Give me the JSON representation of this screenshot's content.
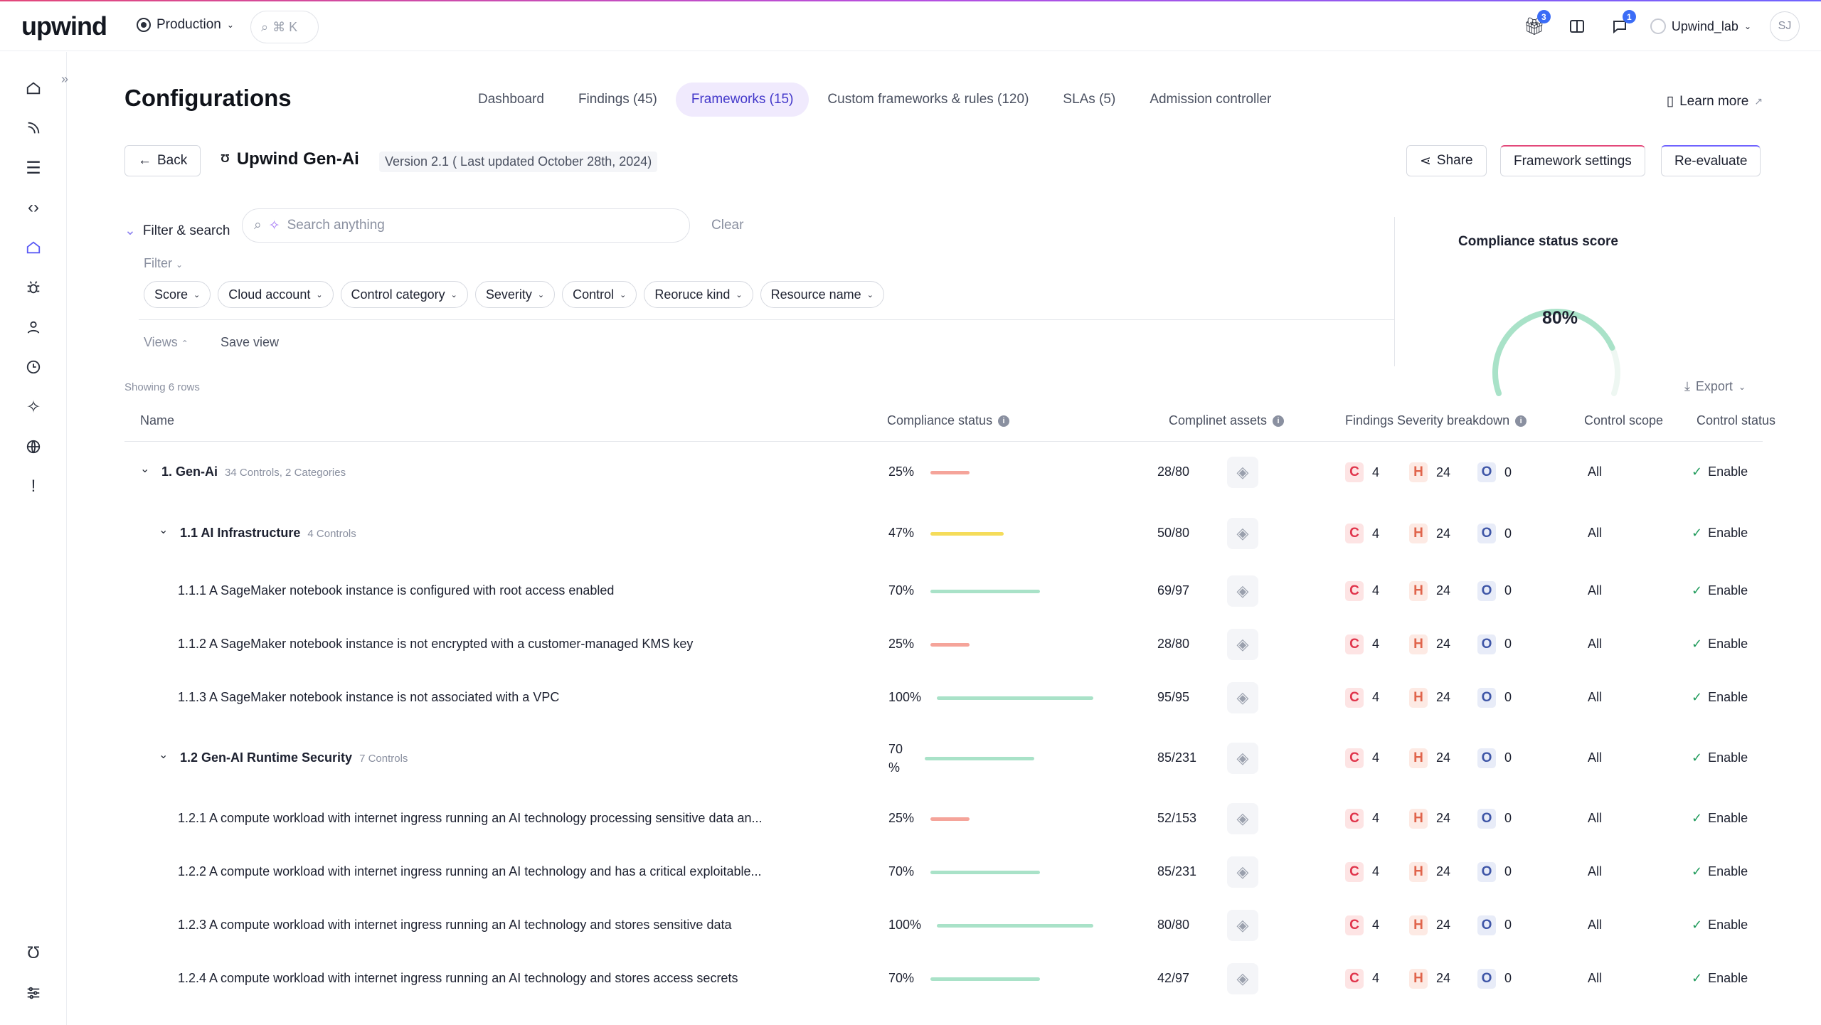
{
  "app": {
    "logo": "upwind",
    "environment": "Production",
    "shortcut": "⌘ K",
    "user": "Upwind_lab",
    "avatar": "SJ",
    "badges": {
      "gift": "3",
      "chat": "1"
    }
  },
  "page": {
    "title": "Configurations",
    "learn_more": "Learn more"
  },
  "tabs": [
    {
      "label": "Dashboard"
    },
    {
      "label": "Findings (45)"
    },
    {
      "label": "Frameworks (15)",
      "active": true
    },
    {
      "label": "Custom frameworks & rules (120)"
    },
    {
      "label": "SLAs (5)"
    },
    {
      "label": "Admission controller"
    }
  ],
  "framework": {
    "back": "Back",
    "name": "Upwind Gen-Ai",
    "version": "Version 2.1 ( Last updated October 28th, 2024)",
    "share": "Share",
    "settings": "Framework settings",
    "reevaluate": "Re-evaluate"
  },
  "filter": {
    "heading": "Filter & search",
    "placeholder": "Search anything",
    "clear": "Clear",
    "filter_label": "Filter",
    "chips": [
      "Score",
      "Cloud account",
      "Control category",
      "Severity",
      "Control",
      "Reoruce kind",
      "Resource name"
    ],
    "views": "Views",
    "save_view": "Save view"
  },
  "score": {
    "title": "Compliance status score",
    "value": "80%",
    "percent": 80
  },
  "table": {
    "showing": "Showing 6 rows",
    "export": "Export",
    "headers": {
      "name": "Name",
      "compliance": "Compliance status",
      "assets": "Complinet assets",
      "findings": "Findings Severity breakdown",
      "scope": "Control scope",
      "status": "Control status"
    },
    "rows": [
      {
        "level": 0,
        "name": "1. Gen-Ai",
        "sub": "34 Controls, 2 Categories",
        "pct": "25%",
        "value": 25,
        "assets": "28/80",
        "c": "4",
        "h": "24",
        "o": "0",
        "scope": "All",
        "status": "Enable"
      },
      {
        "level": 1,
        "name": "1.1 AI Infrastructure",
        "sub": "4 Controls",
        "pct": "47%",
        "value": 47,
        "assets": "50/80",
        "c": "4",
        "h": "24",
        "o": "0",
        "scope": "All",
        "status": "Enable"
      },
      {
        "level": 2,
        "name": "1.1.1 A SageMaker notebook instance is configured with root access enabled",
        "sub": "",
        "pct": "70%",
        "value": 70,
        "assets": "69/97",
        "c": "4",
        "h": "24",
        "o": "0",
        "scope": "All",
        "status": "Enable"
      },
      {
        "level": 2,
        "name": "1.1.2 A SageMaker notebook instance is not encrypted with a customer-managed KMS key",
        "sub": "",
        "pct": "25%",
        "value": 25,
        "assets": "28/80",
        "c": "4",
        "h": "24",
        "o": "0",
        "scope": "All",
        "status": "Enable"
      },
      {
        "level": 2,
        "name": "1.1.3 A SageMaker notebook instance is not associated with a VPC",
        "sub": "",
        "pct": "100%",
        "value": 100,
        "assets": "95/95",
        "c": "4",
        "h": "24",
        "o": "0",
        "scope": "All",
        "status": "Enable"
      },
      {
        "level": 1,
        "name": "1.2 Gen-AI Runtime Security",
        "sub": "7 Controls",
        "pct": "70 %",
        "value": 70,
        "assets": "85/231",
        "c": "4",
        "h": "24",
        "o": "0",
        "scope": "All",
        "status": "Enable"
      },
      {
        "level": 2,
        "name": "1.2.1 A compute workload with internet ingress running an AI technology processing sensitive data an...",
        "sub": "",
        "pct": "25%",
        "value": 25,
        "assets": "52/153",
        "c": "4",
        "h": "24",
        "o": "0",
        "scope": "All",
        "status": "Enable"
      },
      {
        "level": 2,
        "name": "1.2.2 A compute workload with internet ingress running an AI technology and has a critical exploitable...",
        "sub": "",
        "pct": "70%",
        "value": 70,
        "assets": "85/231",
        "c": "4",
        "h": "24",
        "o": "0",
        "scope": "All",
        "status": "Enable"
      },
      {
        "level": 2,
        "name": "1.2.3 A compute workload with internet ingress running an AI technology and stores sensitive data",
        "sub": "",
        "pct": "100%",
        "value": 100,
        "assets": "80/80",
        "c": "4",
        "h": "24",
        "o": "0",
        "scope": "All",
        "status": "Enable"
      },
      {
        "level": 2,
        "name": "1.2.4 A compute workload with internet ingress running an AI technology and stores access secrets",
        "sub": "",
        "pct": "70%",
        "value": 70,
        "assets": "42/97",
        "c": "4",
        "h": "24",
        "o": "0",
        "scope": "All",
        "status": "Enable"
      }
    ]
  },
  "colors": {
    "low": "#f5a49a",
    "mid": "#f5dc5a",
    "high": "#a9e2c8",
    "accent": "#5b5bf5"
  }
}
